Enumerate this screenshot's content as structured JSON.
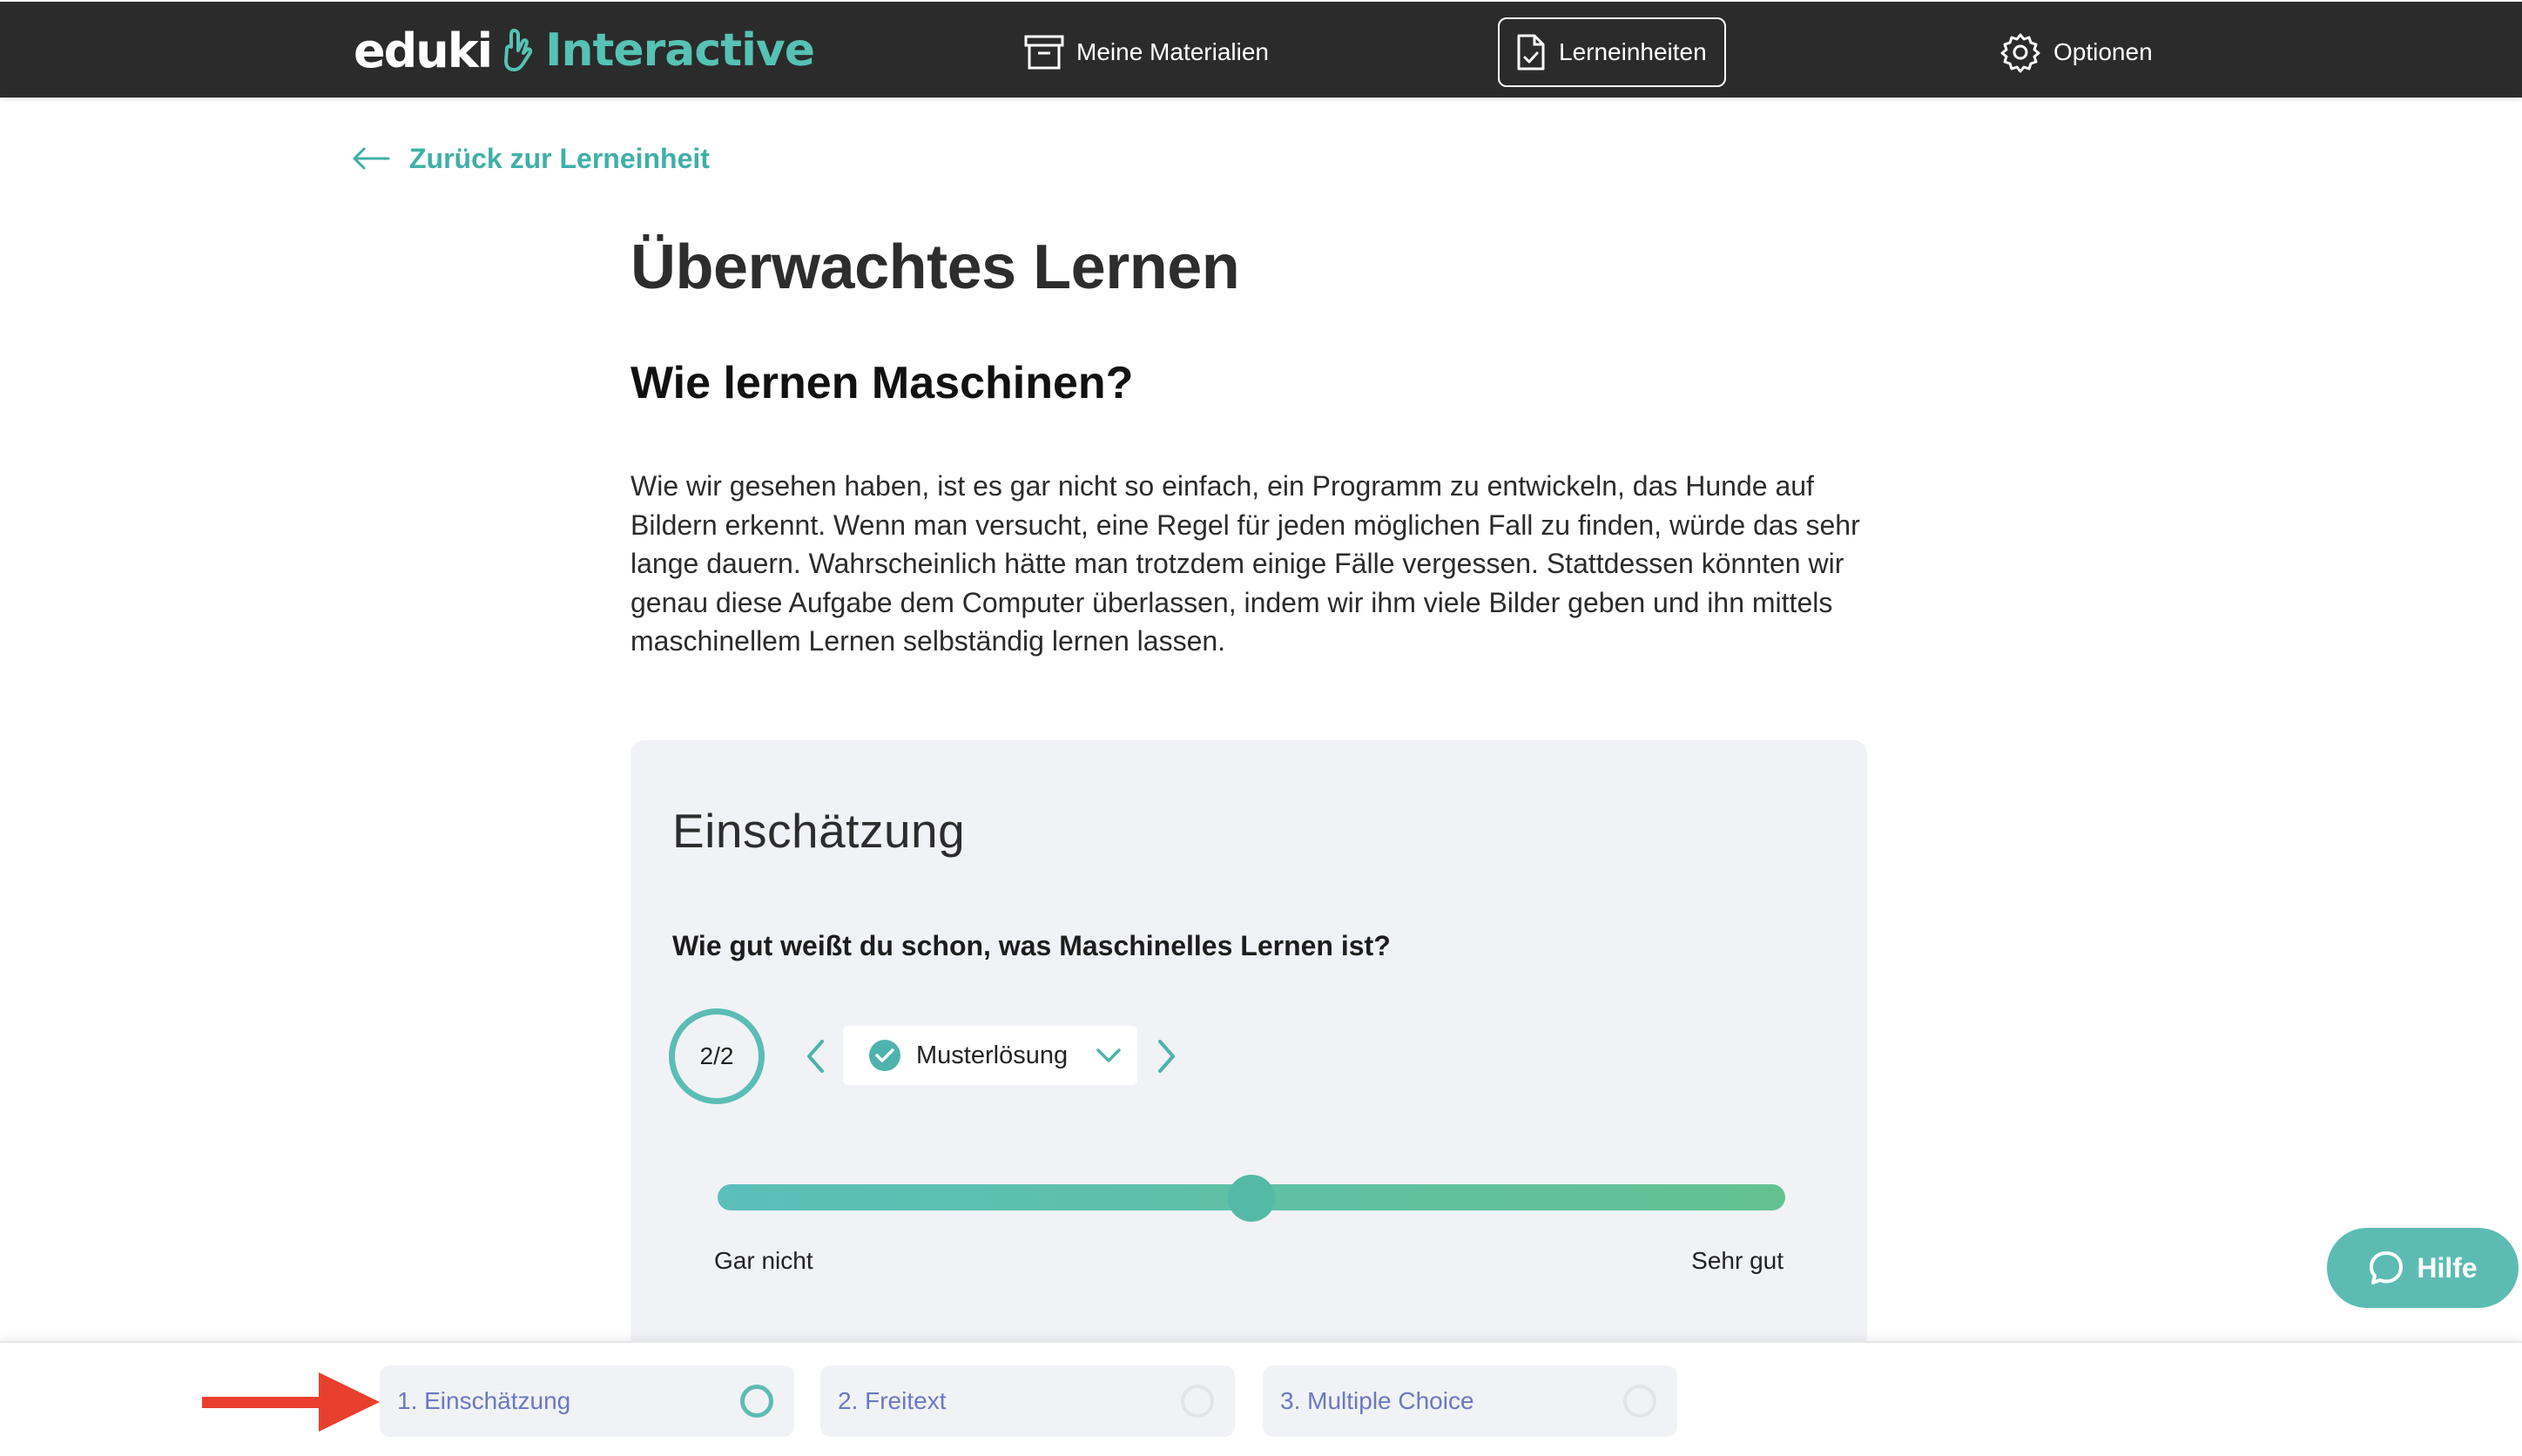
{
  "header": {
    "logo_main": "eduki",
    "logo_accent": "Interactive",
    "nav": [
      {
        "label": "Meine Materialien",
        "icon": "archive-box-icon"
      },
      {
        "label": "Lerneinheiten",
        "icon": "document-check-icon",
        "active": true
      },
      {
        "label": "Optionen",
        "icon": "gear-icon"
      }
    ]
  },
  "back_link": {
    "label": "Zurück zur Lerneinheit",
    "icon": "arrow-left-icon"
  },
  "page": {
    "title": "Überwachtes Lernen",
    "subtitle": "Wie lernen Maschinen?",
    "paragraph": "Wie wir gesehen haben, ist es gar nicht so einfach, ein Programm zu entwickeln, das Hunde auf Bildern erkennt. Wenn man versucht, eine Regel für jeden möglichen Fall zu finden, würde das sehr lange dauern. Wahrscheinlich hätte man trotzdem einige Fälle vergessen. Stattdessen könnten wir genau diese Aufgabe dem Computer überlassen, indem wir ihm viele Bilder geben und ihn mittels maschinellem Lernen selbständig lernen lassen."
  },
  "card": {
    "title": "Einschätzung",
    "question": "Wie gut weißt du schon, was Maschinelles Lernen ist?",
    "counter": "2/2",
    "select_value": "Musterlösung",
    "slider": {
      "value_fraction": 0.5,
      "min_label": "Gar nicht",
      "max_label": "Sehr gut"
    }
  },
  "help_button": {
    "label": "Hilfe"
  },
  "tabs": [
    {
      "label": "1. Einschätzung",
      "active": true
    },
    {
      "label": "2. Freitext",
      "active": false
    },
    {
      "label": "3. Multiple Choice",
      "active": false
    }
  ],
  "colors": {
    "topbar": "#2b2b2b",
    "accent": "#5cbcb3",
    "link": "#3fb0a7",
    "tab_text": "#6b78c4",
    "card_bg": "#f1f2f5",
    "annotation_arrow": "#e8402d"
  }
}
